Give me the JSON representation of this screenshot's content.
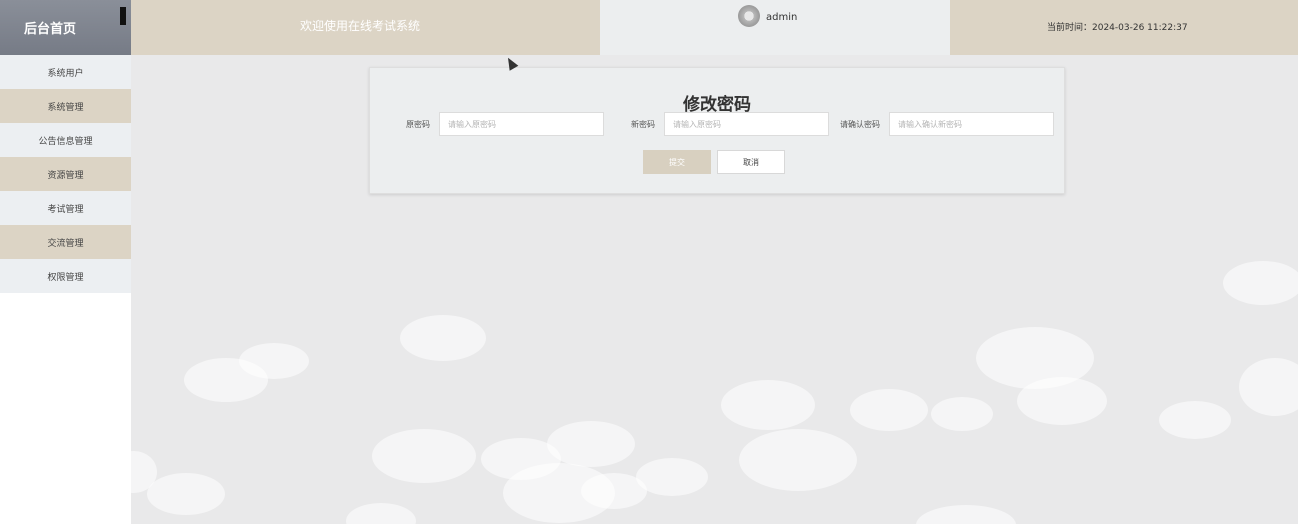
{
  "sidebar": {
    "brand": "后台首页",
    "items": [
      {
        "label": "系统用户"
      },
      {
        "label": "系统管理"
      },
      {
        "label": "公告信息管理"
      },
      {
        "label": "资源管理"
      },
      {
        "label": "考试管理"
      },
      {
        "label": "交流管理"
      },
      {
        "label": "权限管理"
      }
    ]
  },
  "header": {
    "welcome": "欢迎使用在线考试系统",
    "username": "admin",
    "time": "当前时间：2024-03-26 11:22:37"
  },
  "form": {
    "title": "修改密码",
    "fields": [
      {
        "label": "原密码",
        "placeholder": "请输入原密码"
      },
      {
        "label": "新密码",
        "placeholder": "请输入原密码"
      },
      {
        "label": "请确认密码",
        "placeholder": "请输入确认新密码"
      }
    ],
    "submit": "提交",
    "cancel": "取消"
  },
  "colors": {
    "accent": "#dcd4c5",
    "brand_bg": "#7f848e",
    "main_bg": "#e9e9ea"
  }
}
